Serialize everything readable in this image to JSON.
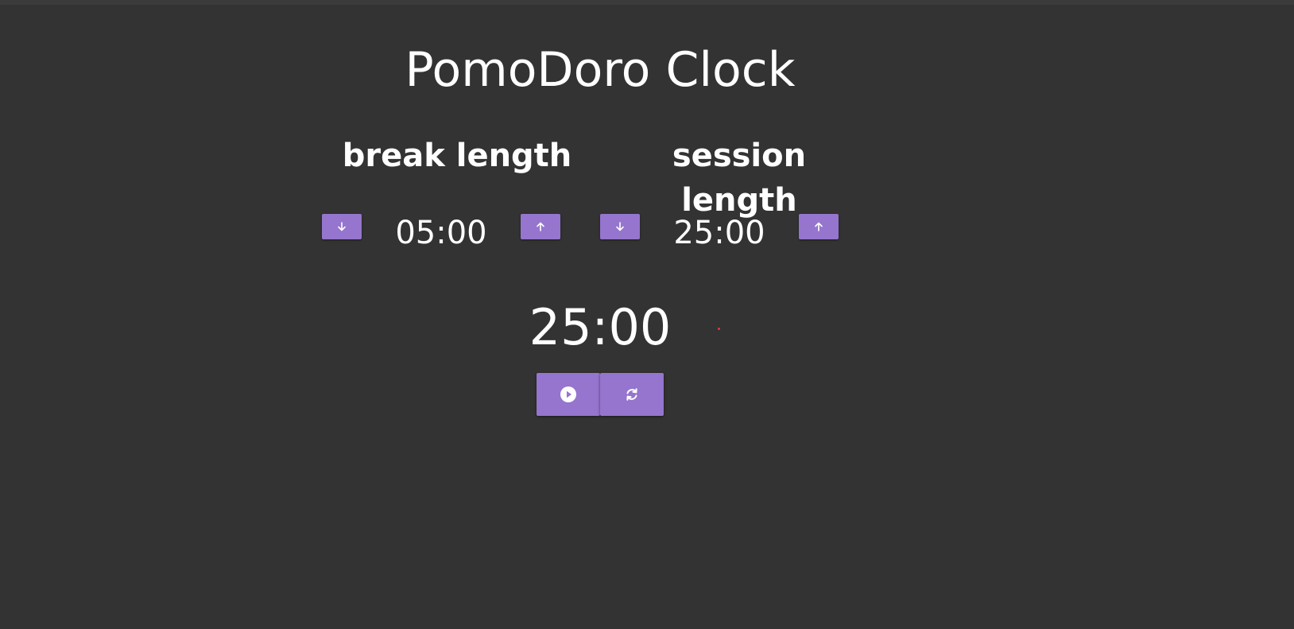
{
  "app": {
    "title": "PomoDoro Clock"
  },
  "break": {
    "label": "break length",
    "value": "05:00",
    "decrease_icon": "arrow-down-icon",
    "increase_icon": "arrow-up-icon"
  },
  "session": {
    "label": "session length",
    "value": "25:00",
    "decrease_icon": "arrow-down-icon",
    "increase_icon": "arrow-up-icon"
  },
  "timer": {
    "display": "25:00",
    "start_icon": "play-circle-icon",
    "reset_icon": "refresh-icon"
  },
  "colors": {
    "background": "#333333",
    "accent": "#9575cd",
    "text": "#ffffff",
    "indicator": "#e53935"
  }
}
